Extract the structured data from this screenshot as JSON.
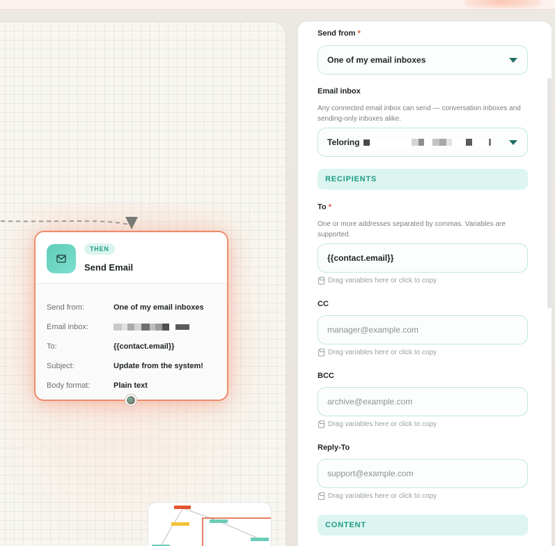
{
  "node": {
    "badge": "THEN",
    "title": "Send Email",
    "rows": [
      {
        "key": "Send from:",
        "value": "One of my email inboxes"
      },
      {
        "key": "Email inbox:",
        "value": ""
      },
      {
        "key": "To:",
        "value": "{{contact.email}}"
      },
      {
        "key": "Subject:",
        "value": "Update from the system!"
      },
      {
        "key": "Body format:",
        "value": "Plain text"
      }
    ]
  },
  "panel": {
    "send_from": {
      "label": "Send from",
      "required_mark": "*",
      "value": "One of my email inboxes"
    },
    "email_inbox": {
      "label": "Email inbox",
      "helper": "Any connected email inbox can send — conversation inboxes and sending-only inboxes alike.",
      "value": "Teloring"
    },
    "recipients_section": "RECIPIENTS",
    "to": {
      "label": "To",
      "required_mark": "*",
      "helper": "One or more addresses separated by commas. Variables are supported.",
      "value": "{{contact.email}}",
      "hint": "Drag variables here or click to copy"
    },
    "cc": {
      "label": "CC",
      "placeholder": "manager@example.com",
      "hint": "Drag variables here or click to copy"
    },
    "bcc": {
      "label": "BCC",
      "placeholder": "archive@example.com",
      "hint": "Drag variables here or click to copy"
    },
    "reply_to": {
      "label": "Reply-To",
      "placeholder": "support@example.com",
      "hint": "Drag variables here or click to copy"
    },
    "content_section": "CONTENT"
  },
  "colors": {
    "accent_teal": "#1f9a86",
    "accent_coral": "#ef8a6c",
    "required_red": "#e4503a"
  },
  "icons": {
    "node_icon": "mail-icon",
    "select_caret": "chevron-down-icon",
    "hint_icon": "clipboard-icon"
  }
}
